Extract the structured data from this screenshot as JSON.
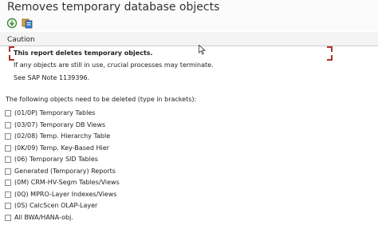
{
  "window": {
    "title": "Removes temporary database objects"
  },
  "toolbar": {
    "buttons": [
      {
        "icon": "execute-icon"
      },
      {
        "icon": "variant-icon"
      }
    ]
  },
  "caution": {
    "caption": "Caution",
    "lines": [
      "This report deletes temporary objects.",
      "If any objects are still in use, crucial processes may terminate.",
      "See SAP Note 1139396."
    ]
  },
  "objects": {
    "intro": "The following objects need to be deleted (type in brackets):",
    "options": [
      {
        "label": "(01/0P) Temporary Tables",
        "checked": false
      },
      {
        "label": "(03/07) Temporary DB Views",
        "checked": false
      },
      {
        "label": "(02/08) Temp. Hierarchy Table",
        "checked": false
      },
      {
        "label": "(0K/09) Temp. Key-Based Hier",
        "checked": false
      },
      {
        "label": "(06) Temporary SID Tables",
        "checked": false
      },
      {
        "label": "Generated (Temporary) Reports",
        "checked": false
      },
      {
        "label": "(0M) CRM-HV-Segm Tables/Views",
        "checked": false
      },
      {
        "label": "(0Q) MPRO-Layer Indexes/Views",
        "checked": false
      },
      {
        "label": "(0S) CalcScen OLAP-Layer",
        "checked": false
      },
      {
        "label": "All BWA/HANA-obj.",
        "checked": false
      }
    ]
  }
}
